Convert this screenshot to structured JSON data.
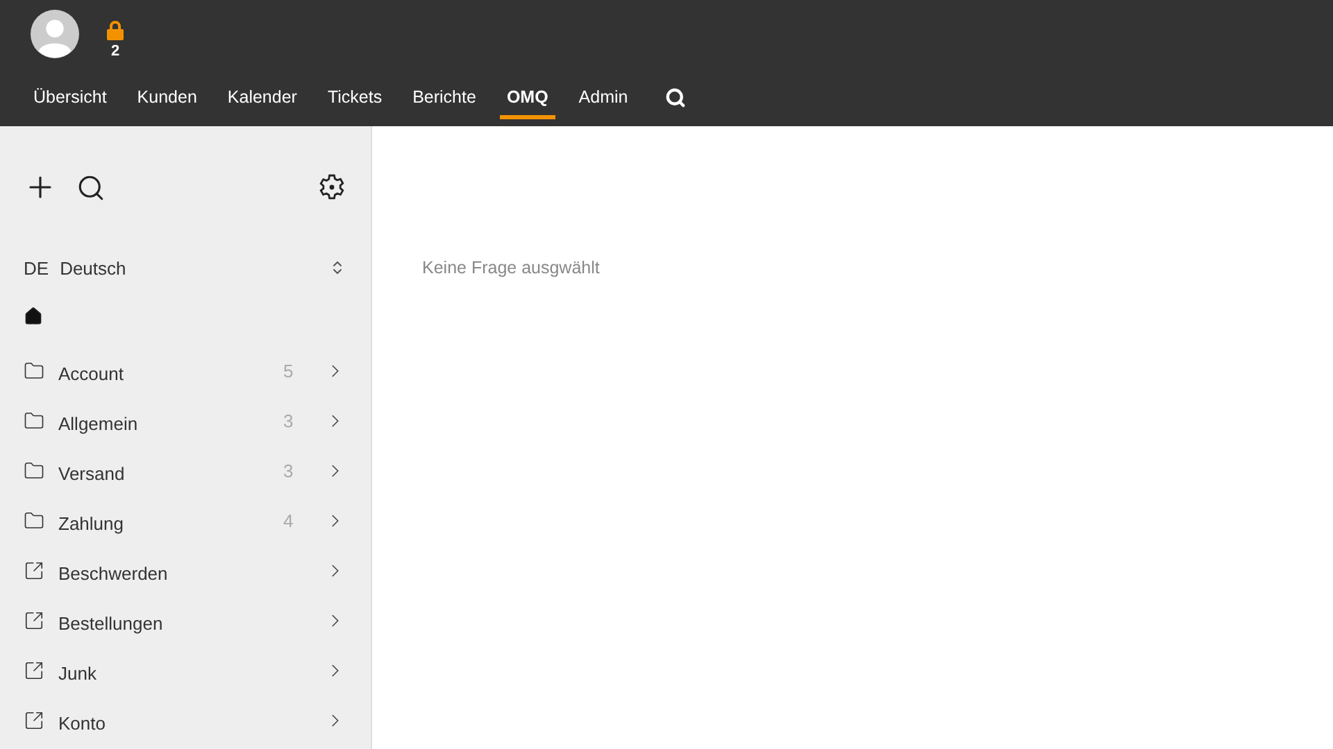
{
  "header": {
    "lock_count": "2",
    "nav": [
      {
        "label": "Übersicht",
        "selected": false
      },
      {
        "label": "Kunden",
        "selected": false
      },
      {
        "label": "Kalender",
        "selected": false
      },
      {
        "label": "Tickets",
        "selected": false
      },
      {
        "label": "Berichte",
        "selected": false
      },
      {
        "label": "OMQ",
        "selected": true
      },
      {
        "label": "Admin",
        "selected": false
      }
    ]
  },
  "sidebar": {
    "language": {
      "code": "DE",
      "name": "Deutsch"
    },
    "categories": [
      {
        "kind": "folder",
        "label": "Account",
        "count": "5"
      },
      {
        "kind": "folder",
        "label": "Allgemein",
        "count": "3"
      },
      {
        "kind": "folder",
        "label": "Versand",
        "count": "3"
      },
      {
        "kind": "folder",
        "label": "Zahlung",
        "count": "4"
      },
      {
        "kind": "link",
        "label": "Beschwerden"
      },
      {
        "kind": "link",
        "label": "Bestellungen"
      },
      {
        "kind": "link",
        "label": "Junk"
      },
      {
        "kind": "link",
        "label": "Konto"
      }
    ]
  },
  "main": {
    "empty_message": "Keine Frage ausgwählt"
  }
}
